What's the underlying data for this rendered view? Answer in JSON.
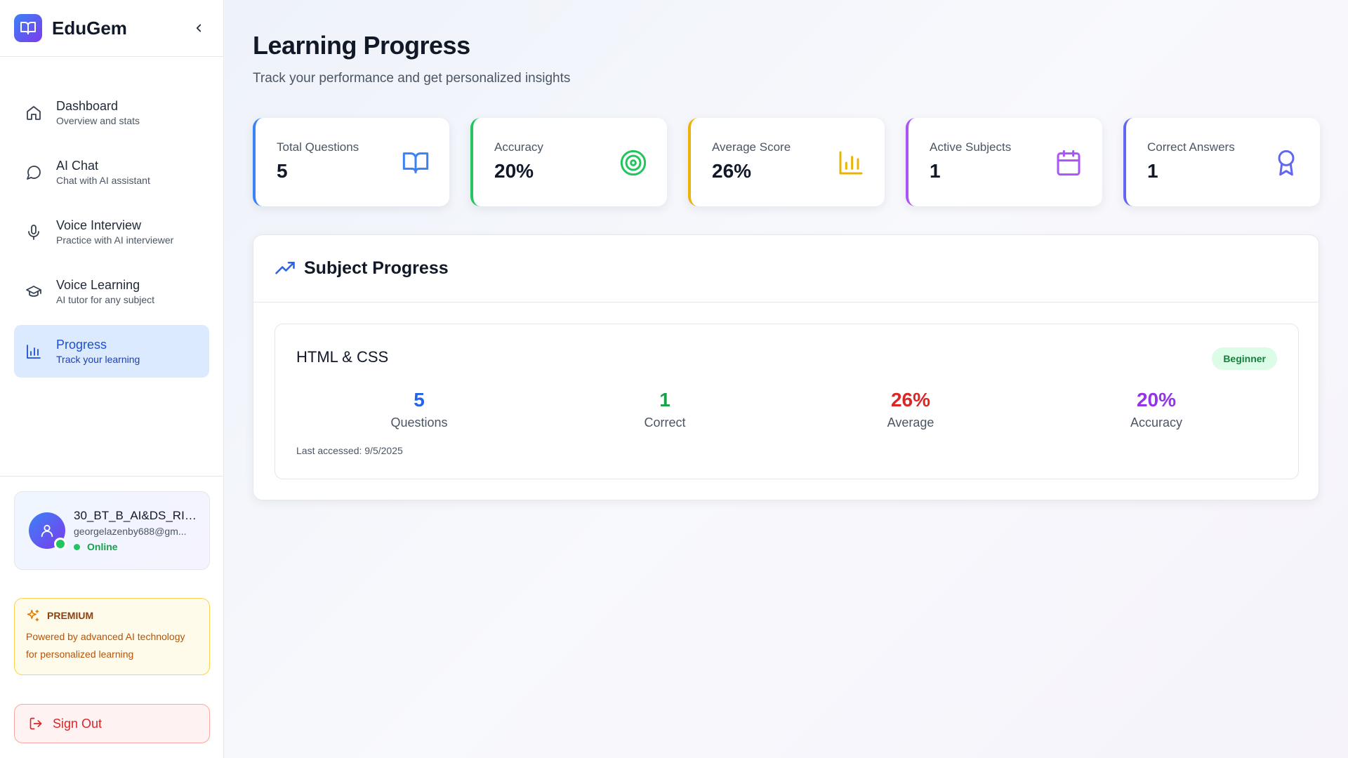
{
  "app": {
    "name": "EduGem"
  },
  "sidebar": {
    "items": [
      {
        "label": "Dashboard",
        "sub": "Overview and stats",
        "icon": "home-icon"
      },
      {
        "label": "AI Chat",
        "sub": "Chat with AI assistant",
        "icon": "chat-bubble-icon"
      },
      {
        "label": "Voice Interview",
        "sub": "Practice with AI interviewer",
        "icon": "microphone-icon"
      },
      {
        "label": "Voice Learning",
        "sub": "AI tutor for any subject",
        "icon": "graduation-cap-icon"
      },
      {
        "label": "Progress",
        "sub": "Track your learning",
        "icon": "bar-chart-icon",
        "active": true
      }
    ]
  },
  "user": {
    "name": "30_BT_B_AI&DS_RIS...",
    "email": "georgelazenby688@gm...",
    "status": "Online"
  },
  "premium": {
    "title": "PREMIUM",
    "text": "Powered by advanced AI technology for personalized learning"
  },
  "signout": {
    "label": "Sign Out"
  },
  "page": {
    "title": "Learning Progress",
    "subtitle": "Track your performance and get personalized insights"
  },
  "stats": [
    {
      "label": "Total Questions",
      "value": "5",
      "icon": "book-icon",
      "color": "#3b82f6"
    },
    {
      "label": "Accuracy",
      "value": "20%",
      "icon": "target-icon",
      "color": "#22c55e"
    },
    {
      "label": "Average Score",
      "value": "26%",
      "icon": "bar-chart-icon",
      "color": "#eab308"
    },
    {
      "label": "Active Subjects",
      "value": "1",
      "icon": "calendar-icon",
      "color": "#a855f7"
    },
    {
      "label": "Correct Answers",
      "value": "1",
      "icon": "award-icon",
      "color": "#6366f1"
    }
  ],
  "subject_progress": {
    "title": "Subject Progress",
    "subjects": [
      {
        "name": "HTML & CSS",
        "level": "Beginner",
        "metrics": [
          {
            "value": "5",
            "label": "Questions",
            "color": "#2563eb"
          },
          {
            "value": "1",
            "label": "Correct",
            "color": "#16a34a"
          },
          {
            "value": "26%",
            "label": "Average",
            "color": "#dc2626"
          },
          {
            "value": "20%",
            "label": "Accuracy",
            "color": "#9333ea"
          }
        ],
        "last_accessed": "Last accessed: 9/5/2025"
      }
    ]
  }
}
